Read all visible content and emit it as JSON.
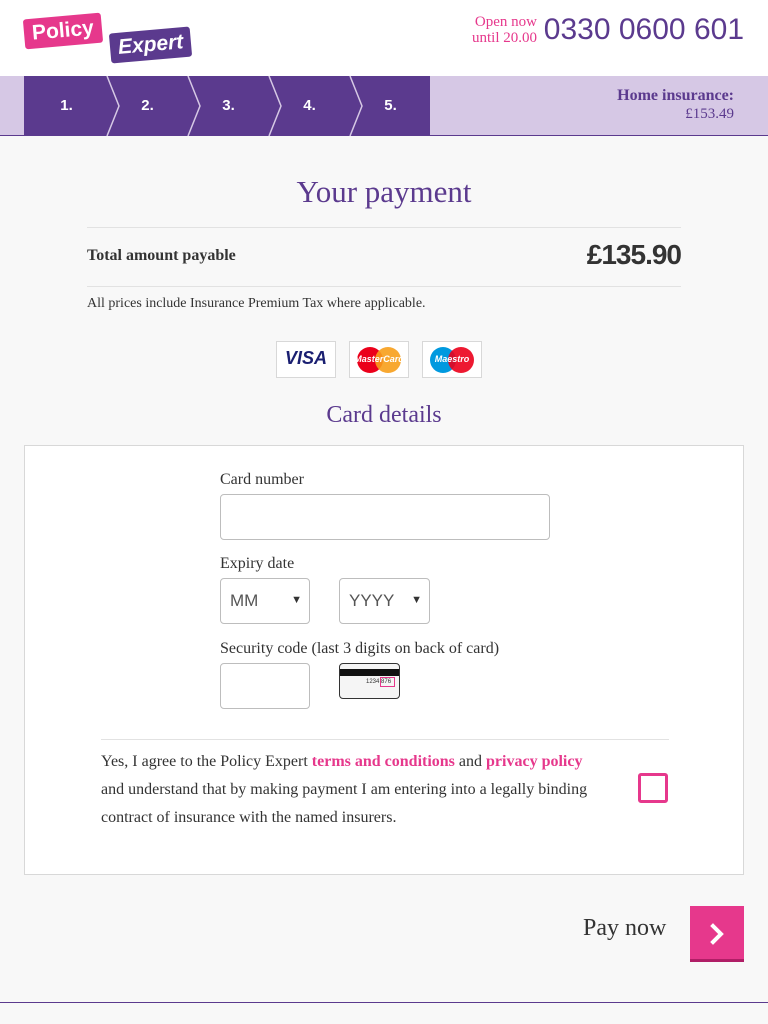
{
  "header": {
    "logo_word1": "Policy",
    "logo_word2": "Expert",
    "open_line1": "Open now",
    "open_line2": "until 20.00",
    "phone": "0330 0600 601"
  },
  "steps": {
    "items": [
      "1.",
      "2.",
      "3.",
      "4.",
      "5."
    ],
    "premium_label": "Home insurance:",
    "premium_value": "£153.49"
  },
  "payment": {
    "title": "Your payment",
    "total_label": "Total amount payable",
    "total_value": "£135.90",
    "tax_note": "All prices include Insurance Premium Tax where applicable.",
    "card_brands": {
      "visa": "VISA",
      "mastercard": "MasterCard",
      "maestro": "Maestro"
    },
    "card_icon_digits": "1234 876"
  },
  "card_details": {
    "title": "Card details",
    "card_number_label": "Card number",
    "card_number_value": "",
    "expiry_label": "Expiry date",
    "expiry_month": "MM",
    "expiry_year": "YYYY",
    "security_label": "Security code (last 3 digits on back of card)",
    "security_value": ""
  },
  "agreement": {
    "text_before": "Yes, I agree to the Policy Expert ",
    "terms_link": "terms and conditions",
    "and": " and ",
    "privacy_link": "privacy policy",
    "text_after": " and understand that by making payment I am entering into a legally binding contract of insurance with the named insurers.",
    "checked": false
  },
  "actions": {
    "pay_now_label": "Pay now",
    "pay_now_icon": "chevron-right-icon"
  },
  "colors": {
    "brand_purple": "#5b3a8e",
    "brand_pink": "#e6388c",
    "steps_bg": "#d6c8e5"
  }
}
